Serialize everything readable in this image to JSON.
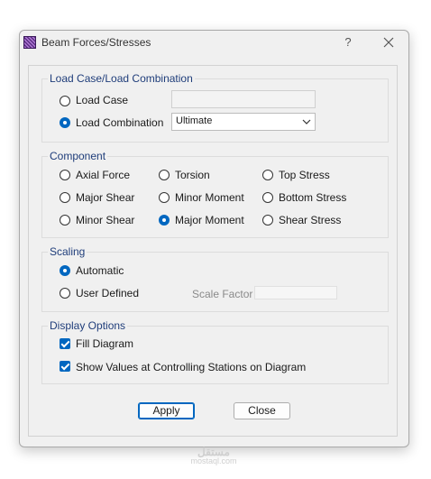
{
  "window": {
    "title": "Beam Forces/Stresses",
    "help_glyph": "?"
  },
  "load_case": {
    "legend": "Load Case/Load Combination",
    "option_case": "Load Case",
    "option_combination": "Load Combination",
    "selected": "Load Combination",
    "combination_value": "Ultimate"
  },
  "component": {
    "legend": "Component",
    "options": [
      "Axial Force",
      "Torsion",
      "Top Stress",
      "Major Shear",
      "Minor Moment",
      "Bottom Stress",
      "Minor Shear",
      "Major Moment",
      "Shear Stress"
    ],
    "selected": "Major Moment"
  },
  "scaling": {
    "legend": "Scaling",
    "option_automatic": "Automatic",
    "option_user": "User Defined",
    "selected": "Automatic",
    "scale_factor_label": "Scale Factor"
  },
  "display": {
    "legend": "Display Options",
    "fill_diagram": "Fill Diagram",
    "fill_diagram_checked": true,
    "show_values": "Show Values at Controlling Stations on Diagram",
    "show_values_checked": true
  },
  "buttons": {
    "apply": "Apply",
    "close": "Close"
  },
  "colors": {
    "accent": "#0067c0",
    "legend_text": "#1f3d7a",
    "dialog_bg": "#f0f0f0"
  },
  "watermark": {
    "arabic": "مستقل",
    "latin": "mostaql.com"
  }
}
